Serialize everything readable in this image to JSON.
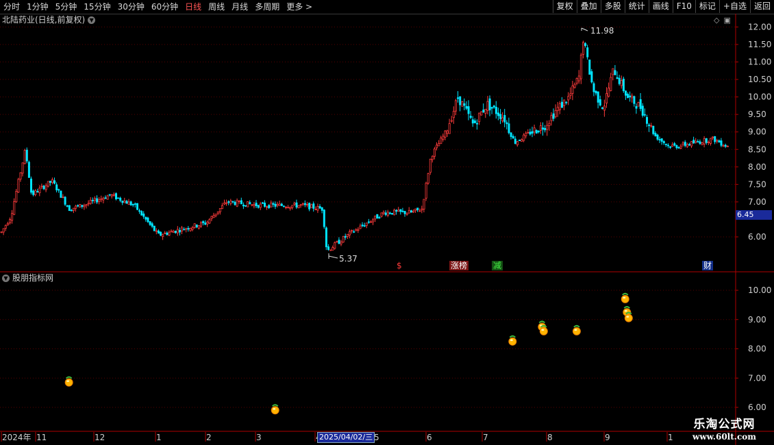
{
  "toolbar": {
    "periods": [
      "分时",
      "1分钟",
      "5分钟",
      "15分钟",
      "30分钟",
      "60分钟",
      "日线",
      "周线",
      "月线",
      "多周期",
      "更多 >"
    ],
    "active_period": "日线",
    "right_buttons": [
      "复权",
      "叠加",
      "多股",
      "统计",
      "画线",
      "F10",
      "标记",
      "+自选",
      "返回"
    ]
  },
  "main": {
    "title": "北陆药业(日线,前复权)",
    "price_labels": [
      "12.00",
      "11.50",
      "11.00",
      "10.50",
      "10.00",
      "9.50",
      "9.00",
      "8.50",
      "8.00",
      "7.50",
      "7.00",
      "6.00"
    ],
    "current_price": "6.45",
    "high_label": "11.98",
    "low_label": "5.37",
    "event_markers": [
      {
        "text": "$",
        "color": "#ff3b3b"
      },
      {
        "text": "涨榜",
        "color": "#ffffff",
        "bg": "#7a1414"
      },
      {
        "text": "减",
        "color": "#44ee44",
        "bg": "#145014"
      },
      {
        "text": "财",
        "color": "#ffffff",
        "bg": "#14308a"
      }
    ]
  },
  "indicator": {
    "title": "股朋指标网",
    "price_labels": [
      "10.00",
      "9.00",
      "8.00",
      "7.00",
      "6.00"
    ],
    "markers": [
      {
        "x": "2024-10-10",
        "value": 6.85
      },
      {
        "x": "2025-02-06",
        "value": 5.9
      },
      {
        "x": "2025-06-23",
        "value": 8.25
      },
      {
        "x": "2025-07-10",
        "value": 8.75
      },
      {
        "x": "2025-07-11",
        "value": 8.6
      },
      {
        "x": "2025-07-30",
        "value": 8.6
      },
      {
        "x": "2025-08-27",
        "value": 9.7
      },
      {
        "x": "2025-08-28",
        "value": 9.25
      },
      {
        "x": "2025-08-29",
        "value": 9.05
      }
    ]
  },
  "axis": {
    "labels": [
      "2024年",
      "11",
      "12",
      "1",
      "2",
      "3",
      "4",
      "5",
      "6",
      "7",
      "8",
      "9",
      "1"
    ],
    "cursor_date": "2025/04/02/三"
  },
  "colors": {
    "up": "#ff3b3b",
    "down": "#00e5ff",
    "grid": "#5a0000",
    "axis": "#b00000",
    "background": "#000000"
  },
  "watermark": {
    "line1": "乐淘公式网",
    "line2": "www.60lt.com"
  }
}
